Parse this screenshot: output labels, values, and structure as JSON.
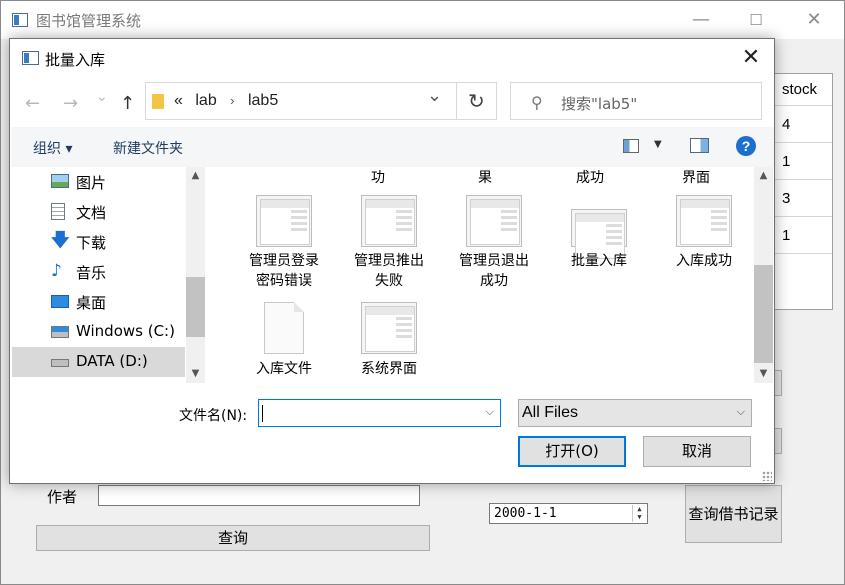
{
  "main_window": {
    "title": "图书馆管理系统",
    "controls": {
      "minimize": "—",
      "maximize": "☐",
      "close": "✕"
    },
    "table": {
      "header": "stock",
      "values": [
        "4",
        "1",
        "3",
        "1"
      ]
    },
    "author_label": "作者",
    "author_value": "",
    "query_button": "查询",
    "date_value": "2000-1-1",
    "borrow_button": "查询借书记录"
  },
  "dialog": {
    "title": "批量入库",
    "close": "✕",
    "nav": {
      "back": "←",
      "forward": "→",
      "recent": "⌄",
      "up": "↑"
    },
    "address": {
      "chevrons": "«",
      "path": [
        "lab",
        "lab5"
      ],
      "sep": "›",
      "dropdown": "⌄",
      "refresh": "↻"
    },
    "search_placeholder": "搜索\"lab5\"",
    "toolbar": {
      "organize": "组织 ▾",
      "new_folder": "新建文件夹",
      "view_drop": "▼",
      "help": "?"
    },
    "sidebar": [
      {
        "label": "图片",
        "icon": "pictures-icon"
      },
      {
        "label": "文档",
        "icon": "documents-icon"
      },
      {
        "label": "下载",
        "icon": "downloads-icon"
      },
      {
        "label": "音乐",
        "icon": "music-icon"
      },
      {
        "label": "桌面",
        "icon": "desktop-icon"
      },
      {
        "label": "Windows (C:)",
        "icon": "drive-c-icon"
      },
      {
        "label": "DATA (D:)",
        "icon": "drive-d-icon",
        "selected": true
      }
    ],
    "top_partial_labels": [
      "功",
      "果",
      "成功",
      "界面"
    ],
    "files": [
      {
        "name": "管理员登录密码错误",
        "line1": "管理员登录",
        "line2": "密码错误",
        "kind": "image"
      },
      {
        "name": "管理员推出失败",
        "line1": "管理员推出",
        "line2": "失败",
        "kind": "image"
      },
      {
        "name": "管理员退出成功",
        "line1": "管理员退出",
        "line2": "成功",
        "kind": "image"
      },
      {
        "name": "批量入库",
        "line1": "批量入库",
        "line2": "",
        "kind": "image"
      },
      {
        "name": "入库成功",
        "line1": "入库成功",
        "line2": "",
        "kind": "image"
      },
      {
        "name": "入库文件",
        "line1": "入库文件",
        "line2": "",
        "kind": "document"
      },
      {
        "name": "系统界面",
        "line1": "系统界面",
        "line2": "",
        "kind": "image"
      }
    ],
    "filename_label": "文件名(N):",
    "filename_value": "",
    "filetype_value": "All Files",
    "open_button": "打开(O)",
    "cancel_button": "取消"
  }
}
